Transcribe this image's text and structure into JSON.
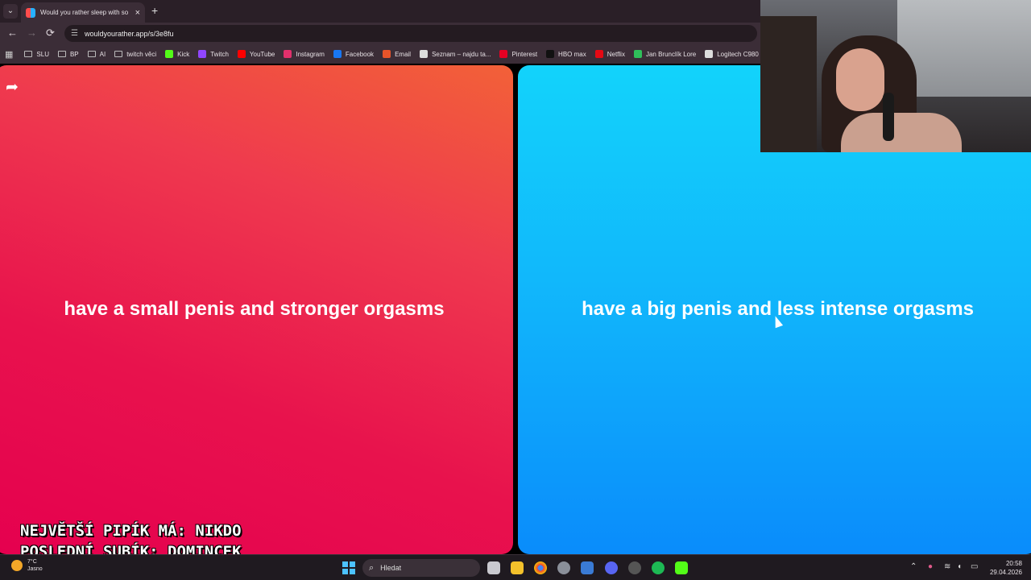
{
  "browser": {
    "tab_title": "Would you rather sleep with so",
    "tab_close": "×",
    "new_tab": "+",
    "url": "wouldyourather.app/s/3e8fu",
    "nav": {
      "back": "←",
      "forward": "→",
      "reload": "⟳",
      "tab_menu": "⌄"
    }
  },
  "bookmarks": [
    {
      "label": "SLU",
      "icon": "folder-icon",
      "color": ""
    },
    {
      "label": "BP",
      "icon": "folder-icon",
      "color": ""
    },
    {
      "label": "AI",
      "icon": "folder-icon",
      "color": ""
    },
    {
      "label": "twitch věci",
      "icon": "folder-icon",
      "color": ""
    },
    {
      "label": "Kick",
      "icon": "kick-icon",
      "color": "#53fc18"
    },
    {
      "label": "Twitch",
      "icon": "twitch-icon",
      "color": "#9146ff"
    },
    {
      "label": "YouTube",
      "icon": "youtube-icon",
      "color": "#ff0000"
    },
    {
      "label": "Instagram",
      "icon": "instagram-icon",
      "color": "#e1306c"
    },
    {
      "label": "Facebook",
      "icon": "facebook-icon",
      "color": "#1877f2"
    },
    {
      "label": "Email",
      "icon": "email-icon",
      "color": "#e8542a"
    },
    {
      "label": "Seznam – najdu ta...",
      "icon": "seznam-icon",
      "color": "#dddddd"
    },
    {
      "label": "Pinterest",
      "icon": "pinterest-icon",
      "color": "#e60023"
    },
    {
      "label": "HBO max",
      "icon": "hbo-icon",
      "color": "#111111"
    },
    {
      "label": "Netflix",
      "icon": "netflix-icon",
      "color": "#e50914"
    },
    {
      "label": "Jan Brunclík Lore",
      "icon": "lore-icon",
      "color": "#2fbf5a"
    },
    {
      "label": "Logitech C980",
      "icon": "logitech-icon",
      "color": "#dddddd"
    }
  ],
  "game": {
    "option_a": "have a small penis and stronger orgasms",
    "option_b": "have a big penis and less intense orgasms",
    "share_icon": "➦"
  },
  "overlay": {
    "line1": "NEJVĚTŠÍ PIPÍK MÁ: NIKDO",
    "line2": "POSLEDNÍ SUBÍK: DOMINCEK"
  },
  "taskbar": {
    "weather_temp": "7°C",
    "weather_cond": "Jasno",
    "search_placeholder": "Hledat",
    "time": "20:58",
    "date": "29.04.2026"
  },
  "colors": {
    "option_a": "#e8124d",
    "option_b": "#11b7fb"
  }
}
